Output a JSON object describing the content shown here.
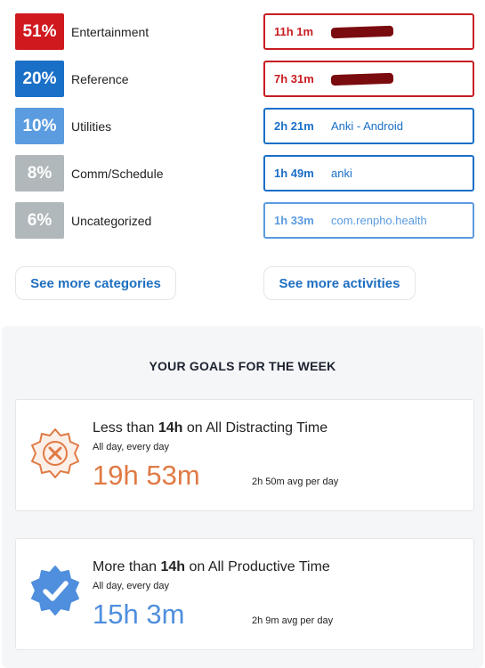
{
  "categories": [
    {
      "percent": "51%",
      "label": "Entertainment",
      "color": "#d0191f"
    },
    {
      "percent": "20%",
      "label": "Reference",
      "color": "#1a6fc7"
    },
    {
      "percent": "10%",
      "label": "Utilities",
      "color": "#5b9be0"
    },
    {
      "percent": "8%",
      "label": "Comm/Schedule",
      "color": "#b0b8bb"
    },
    {
      "percent": "6%",
      "label": "Uncategorized",
      "color": "#b0b8bb"
    }
  ],
  "activities": [
    {
      "time": "11h 1m",
      "name": "",
      "redacted": true,
      "color": "#c81c22"
    },
    {
      "time": "7h 31m",
      "name": "",
      "redacted": true,
      "color": "#c81c22"
    },
    {
      "time": "2h 21m",
      "name": "Anki - Android",
      "redacted": false,
      "color": "#1a6fc7"
    },
    {
      "time": "1h 49m",
      "name": "anki",
      "redacted": false,
      "color": "#1a6fc7"
    },
    {
      "time": "1h 33m",
      "name": "com.renpho.health",
      "redacted": false,
      "color": "#5b9be0"
    }
  ],
  "buttons": {
    "see_more_categories": "See more categories",
    "see_more_activities": "See more activities"
  },
  "goals": {
    "title": "YOUR GOALS FOR THE WEEK",
    "items": [
      {
        "icon": "x-badge-icon",
        "prefix": "Less than ",
        "amount": "14h",
        "suffix": " on All Distracting Time",
        "schedule": "All day, every day",
        "total": "19h 53m",
        "avg": "2h 50m avg per day",
        "color": "#e07a45"
      },
      {
        "icon": "check-badge-icon",
        "prefix": "More than ",
        "amount": "14h",
        "suffix": " on All Productive Time",
        "schedule": "All day, every day",
        "total": "15h 3m",
        "avg": "2h 9m avg per day",
        "color": "#4f8fdd"
      }
    ]
  }
}
